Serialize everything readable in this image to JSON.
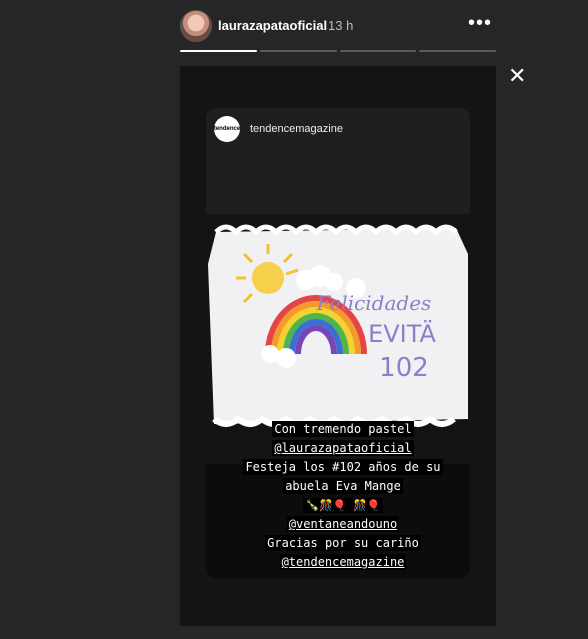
{
  "header": {
    "username": "laurazapataoficial",
    "time": "13 h",
    "more_icon": "•••"
  },
  "progress_segments": 4,
  "close_icon": "✕",
  "post": {
    "brand_logo": "tendence",
    "brand_name": "tendencemagazine",
    "cake_text": {
      "line1": "Felicidades",
      "line2": "EVITÄ",
      "line3": "102"
    },
    "caption": {
      "line1": "Con tremendo pastel",
      "line2": "@laurazapataoficial",
      "line3": "Festeja los #102 años de su",
      "line4": "abuela Eva Mange",
      "line5": "🍾🎊🎈 🎊🎈",
      "line6": "@ventaneandouno",
      "line7": "Gracias por su cariño",
      "line8": "@tendencemagazine"
    }
  }
}
